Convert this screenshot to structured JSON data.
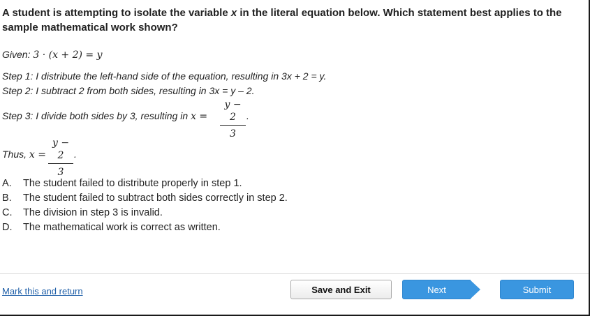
{
  "question": {
    "part1": "A student is attempting to isolate the variable ",
    "variable": "x",
    "part2": " in the literal equation below. Which statement best applies to the sample mathematical work shown?"
  },
  "given": {
    "label": "Given:",
    "equation": "3 · (x + 2) = y"
  },
  "steps": [
    "Step 1: I distribute the left-hand side of the equation, resulting in 3x + 2 = y.",
    "Step 2: I subtract 2 from both sides, resulting in 3x = y – 2.",
    "Step 3: I divide both sides by 3, resulting in"
  ],
  "step3_math": {
    "lhs": "x =",
    "numerator": "y − 2",
    "denominator": "3",
    "end": "."
  },
  "thus": {
    "label": "Thus,",
    "lhs": "x =",
    "numerator": "y − 2",
    "denominator": "3",
    "end": "."
  },
  "choices": [
    {
      "letter": "A.",
      "text": "The student failed to distribute properly in step 1."
    },
    {
      "letter": "B.",
      "text": "The student failed to subtract both sides correctly in step 2."
    },
    {
      "letter": "C.",
      "text": "The division in step 3 is invalid."
    },
    {
      "letter": "D.",
      "text": "The mathematical work is correct as written."
    }
  ],
  "footer": {
    "mark_link": "Mark this and return",
    "save_exit": "Save and Exit",
    "next": "Next",
    "submit": "Submit"
  },
  "colors": {
    "accent": "#3a96e0",
    "link": "#1f5fa8"
  }
}
